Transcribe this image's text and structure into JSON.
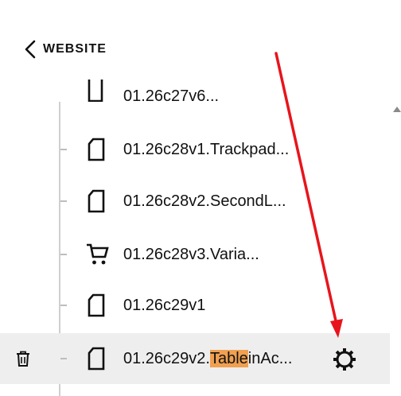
{
  "nav": {
    "back_label": "WEBSITE"
  },
  "pages": [
    {
      "label": "01.26c27v6...",
      "icon": "page-icon",
      "state": "partially-visible"
    },
    {
      "label": "01.26c28v1.Trackpad...",
      "icon": "page-icon"
    },
    {
      "label": "01.26c28v2.SecondL...",
      "icon": "page-icon"
    },
    {
      "label": "01.26c28v3.Varia...",
      "icon": "cart-icon"
    },
    {
      "label": "01.26c29v1",
      "icon": "page-icon"
    },
    {
      "label_prefix": "01.26c29v2.",
      "label_highlight": "Table",
      "label_suffix": "inAc...",
      "icon": "page-icon",
      "selected": true,
      "actions": [
        "trash-icon",
        "gear-icon"
      ]
    }
  ],
  "colors": {
    "highlight": "#f0a050",
    "selected_row_bg": "#eeeeee",
    "annotation_arrow": "#e8141c"
  }
}
